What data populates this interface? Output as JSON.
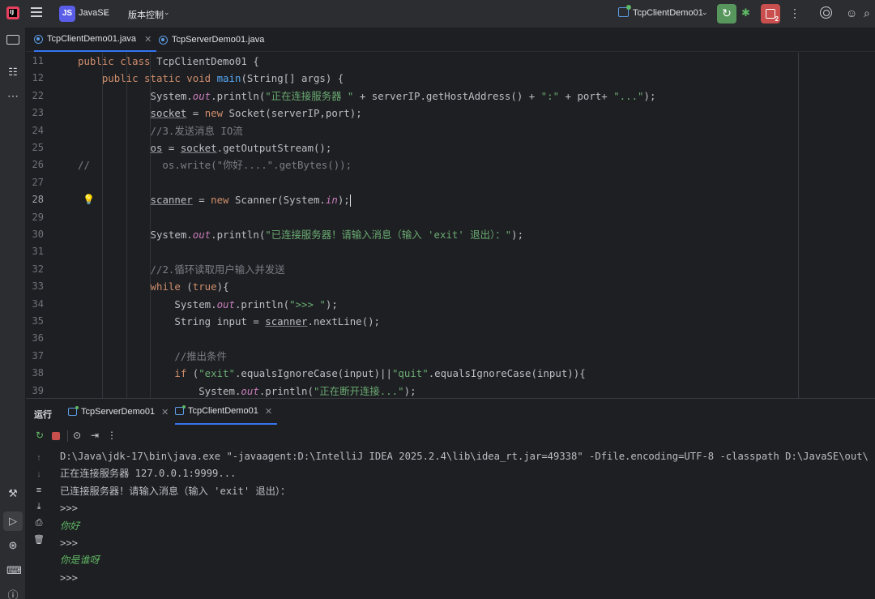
{
  "titlebar": {
    "project_badge": "JS",
    "project_name": "JavaSE",
    "vcs_label": "版本控制",
    "run_config": "TcpClientDemo01",
    "stop_badge": "2"
  },
  "editor_tabs": [
    {
      "label": "TcpClientDemo01.java",
      "active": true
    },
    {
      "label": "TcpServerDemo01.java",
      "active": false
    }
  ],
  "code_lines": [
    {
      "n": "11",
      "html": "<span class=\"kw\">public class</span> TcpClientDemo01 {"
    },
    {
      "n": "12",
      "html": "    <span class=\"kw\">public static void</span> <span class=\"fn\">main</span>(String[] args) {"
    },
    {
      "n": "22",
      "html": "            System.<span class=\"fld\">out</span>.println(<span class=\"str\">\"正在连接服务器 \"</span> + serverIP.getHostAddress() + <span class=\"str\">\":\"</span> + port+ <span class=\"str\">\"...\"</span>);"
    },
    {
      "n": "23",
      "html": "            <span class=\"var\">socket</span> = <span class=\"kw\">new</span> Socket(serverIP,port);"
    },
    {
      "n": "24",
      "html": "            <span class=\"cmt\">//3.发送消息 IO流</span>"
    },
    {
      "n": "25",
      "html": "            <span class=\"var\">os</span> = <span class=\"var\">socket</span>.getOutputStream();"
    },
    {
      "n": "26",
      "html": "<span class=\"cmt\">//            os.write(\"你好....\".getBytes());</span>"
    },
    {
      "n": "27",
      "html": ""
    },
    {
      "n": "28",
      "html": "            <span class=\"var\">scanner</span> = <span class=\"kw\">new</span> Scanner(System.<span class=\"fld\">in</span>);<span class=\"caret\"></span>"
    },
    {
      "n": "29",
      "html": ""
    },
    {
      "n": "30",
      "html": "            System.<span class=\"fld\">out</span>.println(<span class=\"str\">\"已连接服务器！请输入消息（输入 'exit' 退出）：\"</span>);"
    },
    {
      "n": "31",
      "html": ""
    },
    {
      "n": "32",
      "html": "            <span class=\"cmt\">//2.循环读取用户输入并发送</span>"
    },
    {
      "n": "33",
      "html": "            <span class=\"kw\">while</span> (<span class=\"kw\">true</span>){"
    },
    {
      "n": "34",
      "html": "                System.<span class=\"fld\">out</span>.println(<span class=\"str\">\">>> \"</span>);"
    },
    {
      "n": "35",
      "html": "                String input = <span class=\"var\">scanner</span>.nextLine();"
    },
    {
      "n": "36",
      "html": ""
    },
    {
      "n": "37",
      "html": "                <span class=\"cmt\">//推出条件</span>"
    },
    {
      "n": "38",
      "html": "                <span class=\"kw\">if</span> (<span class=\"str\">\"exit\"</span>.equalsIgnoreCase(input)||<span class=\"str\">\"quit\"</span>.equalsIgnoreCase(input)){"
    },
    {
      "n": "39",
      "html": "                    System.<span class=\"fld\">out</span>.println(<span class=\"str\">\"正在断开连接...\"</span>);"
    }
  ],
  "run_panel": {
    "title": "运行",
    "tabs": [
      {
        "label": "TcpServerDemo01",
        "active": false
      },
      {
        "label": "TcpClientDemo01",
        "active": true
      }
    ],
    "console_lines": [
      {
        "text": "D:\\Java\\jdk-17\\bin\\java.exe \"-javaagent:D:\\IntelliJ IDEA 2025.2.4\\lib\\idea_rt.jar=49338\" -Dfile.encoding=UTF-8 -classpath D:\\JavaSE\\out\\",
        "input": false
      },
      {
        "text": "正在连接服务器 127.0.0.1:9999...",
        "input": false
      },
      {
        "text": "已连接服务器！请输入消息（输入 'exit' 退出）：",
        "input": false
      },
      {
        "text": ">>>",
        "input": false
      },
      {
        "text": "你好",
        "input": true
      },
      {
        "text": ">>>",
        "input": false
      },
      {
        "text": "你是谁呀",
        "input": true
      },
      {
        "text": ">>>",
        "input": false
      }
    ]
  },
  "colors": {
    "accent": "#3574f0",
    "rerun": "#57965c",
    "stop": "#c94f4f",
    "keyword": "#cf8e6d",
    "string": "#6aab73"
  }
}
